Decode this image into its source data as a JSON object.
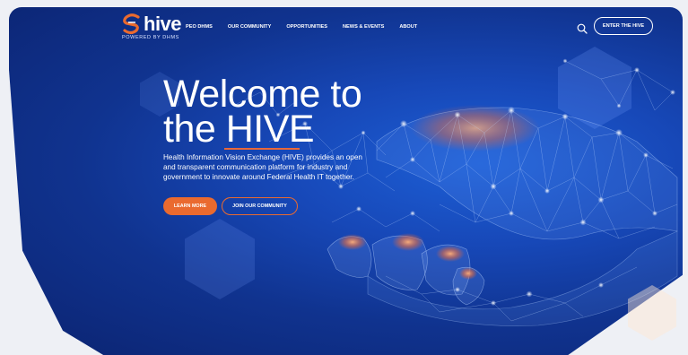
{
  "brand": {
    "name": "hive",
    "tagline": "POWERED BY DHMS"
  },
  "nav": {
    "items": [
      {
        "label": "PEO DHMS"
      },
      {
        "label": "OUR COMMUNITY"
      },
      {
        "label": "OPPORTUNITIES"
      },
      {
        "label": "NEWS & EVENTS"
      },
      {
        "label": "ABOUT"
      }
    ]
  },
  "header": {
    "cta_label": "ENTER THE HIVE",
    "search_icon": "search-icon"
  },
  "hero": {
    "title_line1": "Welcome to",
    "title_line2": "the HIVE",
    "description": "Health Information Vision Exchange (HIVE) provides an open and transparent communication platform for industry and government to innovate around Federal Health IT together.",
    "learn_more_label": "LEARN MORE",
    "join_label": "JOIN OUR COMMUNITY"
  },
  "colors": {
    "accent": "#ea6a2f",
    "hero_blue": "#1748b8",
    "white": "#ffffff"
  }
}
